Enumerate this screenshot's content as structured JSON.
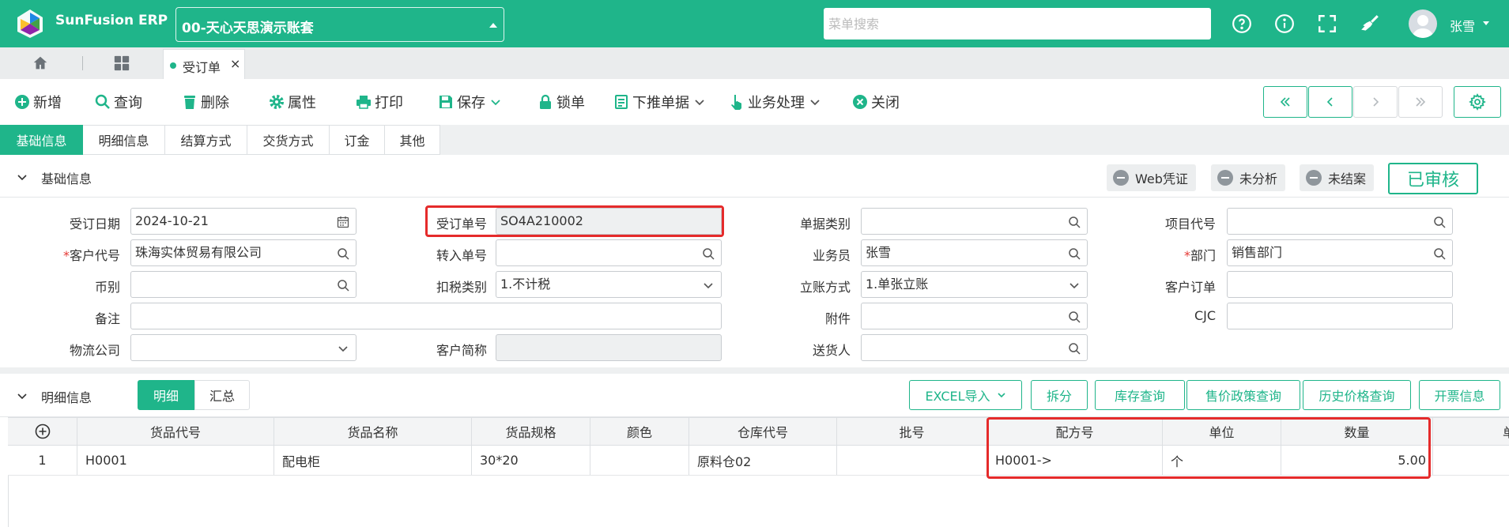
{
  "app": {
    "brand": "SunFusion ERP",
    "account": "00-天心天思演示账套",
    "search_placeholder": "菜单搜索",
    "user_name": "张雪",
    "accent_color": "#1fb58a"
  },
  "nav": {
    "active_tab": "受订单",
    "close_glyph": "×"
  },
  "toolbar": {
    "new": "新增",
    "query": "查询",
    "delete": "删除",
    "attributes": "属性",
    "print": "打印",
    "save": "保存",
    "lock": "锁单",
    "push_down": "下推单据",
    "business": "业务处理",
    "close": "关闭"
  },
  "form_tabs": [
    "基础信息",
    "明细信息",
    "结算方式",
    "交货方式",
    "订金",
    "其他"
  ],
  "basic_section": {
    "title": "基础信息",
    "chips": [
      "Web凭证",
      "未分析",
      "未结案"
    ],
    "approved": "已审核"
  },
  "fields": {
    "order_date": {
      "label": "受订日期",
      "value": "2024-10-21"
    },
    "order_no": {
      "label": "受订单号",
      "value": "SO4A210002"
    },
    "doc_type": {
      "label": "单据类别",
      "value": ""
    },
    "project_code": {
      "label": "项目代号",
      "value": ""
    },
    "customer_code": {
      "label": "客户代号",
      "value": "珠海实体贸易有限公司"
    },
    "transfer_no": {
      "label": "转入单号",
      "value": ""
    },
    "salesperson": {
      "label": "业务员",
      "value": "张雪"
    },
    "department": {
      "label": "部门",
      "value": "销售部门"
    },
    "currency": {
      "label": "币别",
      "value": ""
    },
    "tax_type": {
      "label": "扣税类别",
      "value": "1.不计税"
    },
    "account_method": {
      "label": "立账方式",
      "value": "1.单张立账"
    },
    "customer_order": {
      "label": "客户订单",
      "value": ""
    },
    "remark": {
      "label": "备注",
      "value": ""
    },
    "attachment": {
      "label": "附件",
      "value": ""
    },
    "cjc": {
      "label": "CJC",
      "value": ""
    },
    "logistics": {
      "label": "物流公司",
      "value": ""
    },
    "customer_short": {
      "label": "客户简称",
      "value": ""
    },
    "deliverer": {
      "label": "送货人",
      "value": ""
    }
  },
  "detail_section": {
    "title": "明细信息",
    "seg_detail": "明细",
    "seg_summary": "汇总",
    "buttons": [
      "EXCEL导入",
      "拆分",
      "库存查询",
      "售价政策查询",
      "历史价格查询",
      "开票信息"
    ]
  },
  "grid": {
    "columns": [
      "货品代号",
      "货品名称",
      "货品规格",
      "颜色",
      "仓库代号",
      "批号",
      "配方号",
      "单位",
      "数量",
      "单"
    ],
    "rows": [
      {
        "index": "1",
        "code": "H0001",
        "name": "配电柜",
        "spec": "30*20",
        "color": "",
        "warehouse": "原料仓02",
        "batch": "",
        "formula": "H0001->",
        "unit": "个",
        "qty": "5.00"
      }
    ]
  }
}
